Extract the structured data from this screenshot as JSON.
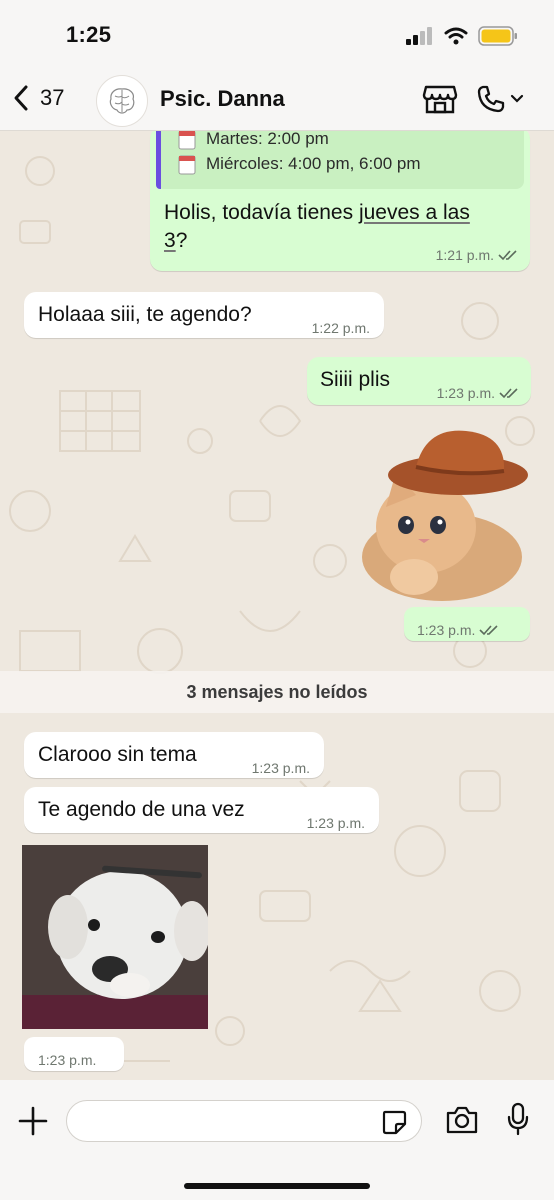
{
  "status_bar": {
    "time": "1:25"
  },
  "header": {
    "back_count": "37",
    "contact_name": "Psic. Danna"
  },
  "messages": {
    "m1": {
      "quote_line1": "Martes: 2:00 pm",
      "quote_line2": "Miércoles: 4:00 pm, 6:00 pm",
      "text_a": "Holis, todavía tienes ",
      "text_link1": "jueves a las",
      "text_link2": "3",
      "text_b": "?",
      "time": "1:21 p.m."
    },
    "m2": {
      "text": "Holaaa siii, te agendo?",
      "time": "1:22 p.m."
    },
    "m3": {
      "text": "Siiii plis",
      "time": "1:23 p.m."
    },
    "m4_sticker": {
      "time": "1:23 p.m."
    },
    "unread_divider": "3 mensajes no leídos",
    "m5": {
      "text": "Clarooo sin tema",
      "time": "1:23 p.m."
    },
    "m6": {
      "text": "Te agendo de una vez",
      "time": "1:23 p.m."
    },
    "m7_photo": {
      "time": "1:23 p.m."
    }
  },
  "colors": {
    "outgoing_bubble": "#d8fdd2",
    "incoming_bubble": "#ffffff",
    "chat_background": "#eee8df",
    "read_ticks": "#5b6b5c",
    "quote_accent": "#6a4fe0"
  }
}
